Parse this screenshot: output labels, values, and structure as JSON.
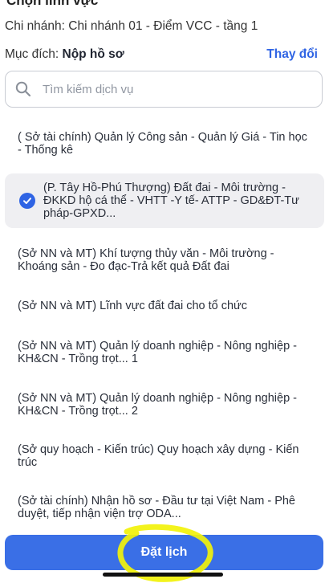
{
  "header": {
    "title": "Chọn lĩnh vực",
    "branch": "Chi nhánh: Chi nhánh 01 - Điểm VCC - tầng 1",
    "purpose_label": "Mục đích: ",
    "purpose_value": "Nộp hồ sơ",
    "change_label": "Thay đổi"
  },
  "search": {
    "placeholder": "Tìm kiếm dịch vụ",
    "value": "",
    "icon": "search-icon"
  },
  "items": [
    {
      "label": "( Sở tài chính) Quản lý Công sản - Quản lý Giá - Tin học - Thống kê",
      "selected": false
    },
    {
      "label": "(P. Tây Hồ-Phú Thượng) Đất đai - Môi trường - ĐKKD hộ cá thể - VHTT -Y tế- ATTP - GD&ĐT-Tư pháp-GPXD...",
      "selected": true
    },
    {
      "label": "(Sở NN và MT) Khí tượng thủy văn - Môi trường - Khoáng sản - Đo đạc-Trả kết quả Đất đai",
      "selected": false
    },
    {
      "label": "(Sở NN và MT) Lĩnh vực đất đai cho tổ chức",
      "selected": false
    },
    {
      "label": "(Sở NN và MT) Quản lý doanh nghiệp - Nông nghiệp - KH&CN - Trồng trọt... 1",
      "selected": false
    },
    {
      "label": "(Sở NN và MT) Quản lý doanh nghiệp - Nông nghiệp - KH&CN - Trồng trọt... 2",
      "selected": false
    },
    {
      "label": "(Sở quy hoạch - Kiến trúc) Quy hoạch xây dựng - Kiến trúc",
      "selected": false
    },
    {
      "label": "(Sở tài chính) Nhận hồ sơ - Đầu tư tại Việt Nam - Phê duyệt, tiếp nhận viện trợ ODA...",
      "selected": false
    }
  ],
  "book_button": {
    "label": "Đặt lịch"
  },
  "colors": {
    "accent": "#2f64e4",
    "button": "#3a6fe6",
    "selected_bg": "#efeff2",
    "highlight_scribble": "#f2f20a"
  }
}
